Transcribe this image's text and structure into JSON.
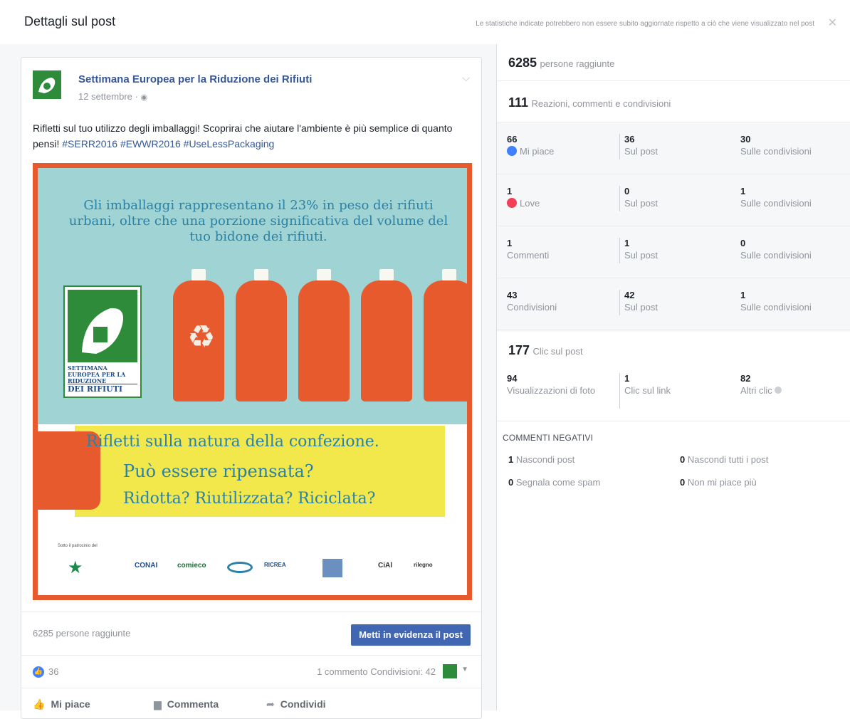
{
  "header": {
    "title": "Dettagli sul post",
    "note": "Le statistiche indicate potrebbero non essere subito aggiornate rispetto a ciò che viene visualizzato nel post",
    "close_symbol": "✕"
  },
  "post": {
    "page_name": "Settimana Europea per la Riduzione dei Rifiuti",
    "date": "12 settembre · ",
    "text_plain": "Rifletti sul tuo utilizzo degli imballaggi! Scoprirai che aiutare l'ambiente è più semplice di quanto pensi! ",
    "hashtags": "#SERR2016 #EWWR2016 #UseLessPackaging",
    "image": {
      "headline": "Gli imballaggi rappresentano il 23% in peso dei rifiuti urbani, oltre che una porzione significativa del volume del tuo bidone dei rifiuti.",
      "logo_text_small": "SETTIMANA EUROPEA PER LA RIDUZIONE",
      "logo_text_big": "DEI RIFIUTI",
      "line1": "Rifletti sulla natura della confezione.",
      "line2": "Può essere ripensata?",
      "line3": "Ridotta? Riutilizzata? Riciclata?",
      "sponsors_title": "Sotto il patrocinio del",
      "sponsors": [
        "CONAI",
        "comieco",
        "RICREA",
        "CiAl",
        "rilegno"
      ]
    },
    "reach_text": "6285 persone raggiunte",
    "boost_button": "Metti in evidenza il post",
    "like_count": "36",
    "comments_shares": "1 commento  Condivisioni: 42",
    "actions": {
      "like": "Mi piace",
      "comment": "Commenta",
      "share": "Condividi"
    }
  },
  "stats": {
    "reach_num": "6285",
    "reach_label": "persone raggiunte",
    "engagement_num": "111",
    "engagement_label": "Reazioni, commenti e condivisioni",
    "rows": [
      {
        "total": "66",
        "label": "Mi piace",
        "on_post": "36",
        "on_post_label": "Sul post",
        "on_shares": "30",
        "on_shares_label": "Sulle condivisioni"
      },
      {
        "total": "1",
        "label": "Love",
        "on_post": "0",
        "on_post_label": "Sul post",
        "on_shares": "1",
        "on_shares_label": "Sulle condivisioni"
      },
      {
        "total": "1",
        "label": "Commenti",
        "on_post": "1",
        "on_post_label": "Sul post",
        "on_shares": "0",
        "on_shares_label": "Sulle condivisioni"
      },
      {
        "total": "43",
        "label": "Condivisioni",
        "on_post": "42",
        "on_post_label": "Sul post",
        "on_shares": "1",
        "on_shares_label": "Sulle condivisioni"
      }
    ],
    "clicks_num": "177",
    "clicks_label": "Clic sul post",
    "clicks": [
      {
        "num": "94",
        "label": "Visualizzazioni di foto"
      },
      {
        "num": "1",
        "label": "Clic sul link"
      },
      {
        "num": "82",
        "label": "Altri clic"
      }
    ],
    "negative_title": "COMMENTI NEGATIVI",
    "negative": [
      {
        "num": "1",
        "label": "Nascondi post"
      },
      {
        "num": "0",
        "label": "Nascondi tutti i post"
      },
      {
        "num": "0",
        "label": "Segnala come spam"
      },
      {
        "num": "0",
        "label": "Non mi piace più"
      }
    ]
  },
  "colors": {
    "accent": "#4267b2",
    "link": "#365899",
    "orange": "#e65a2e",
    "teal": "#9fd3d4",
    "yellow": "#f3e84b",
    "green": "#2e8b3a"
  }
}
